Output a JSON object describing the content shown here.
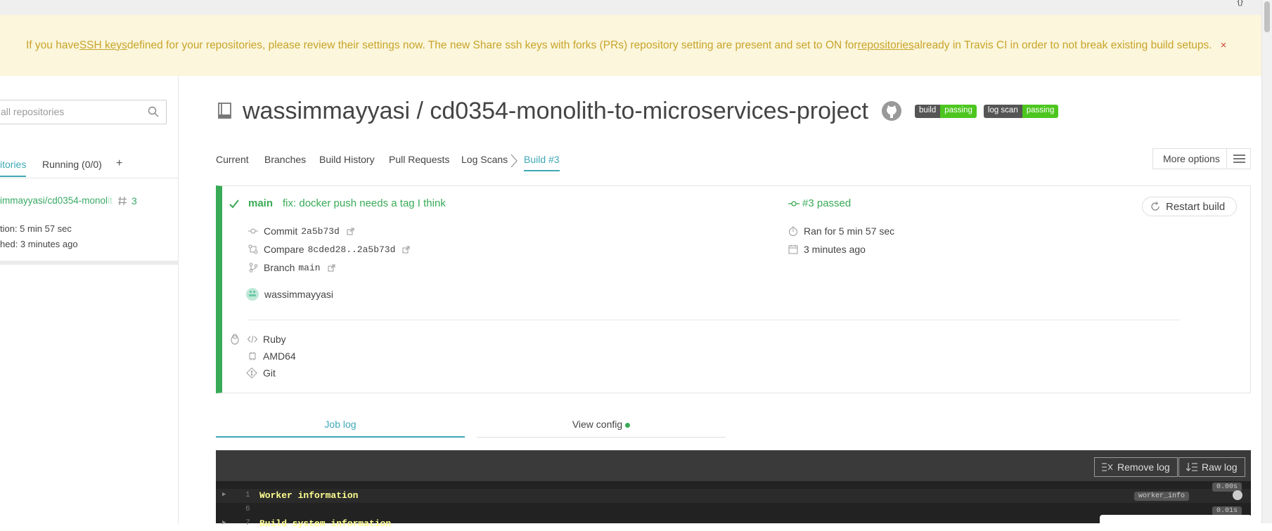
{
  "banner": {
    "part1": "If you have ",
    "link1": "SSH keys ",
    "part2": "defined for your repositories, please review their settings now. The new Share ssh keys with forks (PRs) repository setting are present and set to ON for ",
    "link2": "repositories",
    "part3": " already in Travis CI in order to not break existing build setups.",
    "close": "×"
  },
  "sidebar": {
    "search_placeholder": "all repositories",
    "tab_repos": "itories",
    "tab_running": "Running (0/0)",
    "tab_add": "+",
    "repo_name": "immayyasi/cd0354-monol",
    "repo_name_fade": "it",
    "build_number": "3",
    "duration": "tion: 5 min 57 sec",
    "finished": "hed: 3 minutes ago"
  },
  "repo": {
    "title": "wassimmayyasi / cd0354-monolith-to-microservices-project",
    "badge1_left": "build",
    "badge1_right": "passing",
    "badge2_left": "log scan",
    "badge2_right": "passing"
  },
  "tabs": [
    "Current",
    "Branches",
    "Build History",
    "Pull Requests",
    "Log Scans",
    "Build #3"
  ],
  "more_options": "More options",
  "build": {
    "branch": "main",
    "message": "fix: docker push needs a tag I think",
    "status": "#3 passed",
    "restart": "Restart build",
    "commit_label": "Commit",
    "commit": "2a5b73d",
    "compare_label": "Compare",
    "compare": "8cded28..2a5b73d",
    "branch_label": "Branch",
    "branch_val": "main",
    "author": "wassimmayyasi",
    "ran_for": "Ran for 5 min 57 sec",
    "finished": "3 minutes ago",
    "language": "Ruby",
    "arch": "AMD64",
    "vcs": "Git"
  },
  "log_tabs": {
    "job_log": "Job log",
    "view_config": "View config"
  },
  "log": {
    "remove": "Remove log",
    "raw": "Raw log",
    "lines": [
      {
        "num": "1",
        "text": "Worker information"
      },
      {
        "num": "6",
        "text": ""
      },
      {
        "num": "7",
        "text": "Build system information"
      }
    ],
    "tag_worker": "worker_info",
    "time1": "0.00s",
    "time2": "0.01s"
  },
  "colors": {
    "accent": "#3ea8b5",
    "passed": "#39aa56",
    "banner_bg": "#fbf6dc",
    "banner_text": "#c9a42a"
  }
}
